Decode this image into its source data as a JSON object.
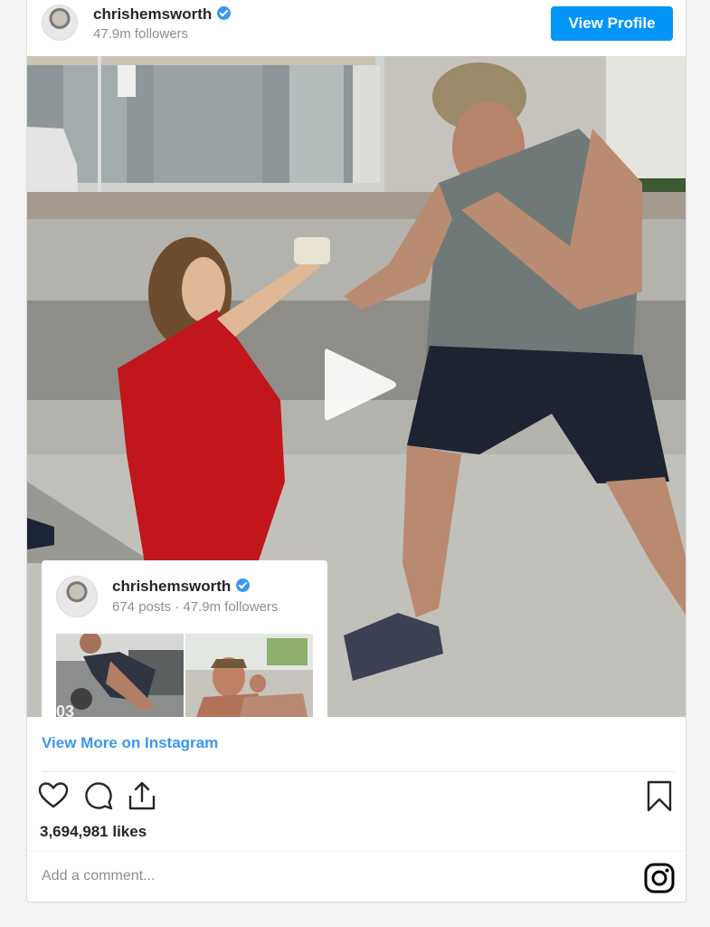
{
  "post": {
    "username": "chrishemsworth",
    "followers": "47.9m followers",
    "view_profile_label": "View Profile",
    "verified_icon": "verified-badge-icon"
  },
  "media": {
    "type": "video",
    "play_icon": "play-icon"
  },
  "profile_card": {
    "username": "chrishemsworth",
    "stats": "674 posts · 47.9m followers"
  },
  "footer": {
    "view_more_label": "View More on Instagram",
    "likes": "3,694,981 likes",
    "comment_placeholder": "Add a comment...",
    "icons": [
      "heart-icon",
      "comment-icon",
      "share-icon",
      "bookmark-icon",
      "instagram-icon"
    ]
  },
  "colors": {
    "accent": "#0095f6",
    "link": "#3897f0"
  }
}
